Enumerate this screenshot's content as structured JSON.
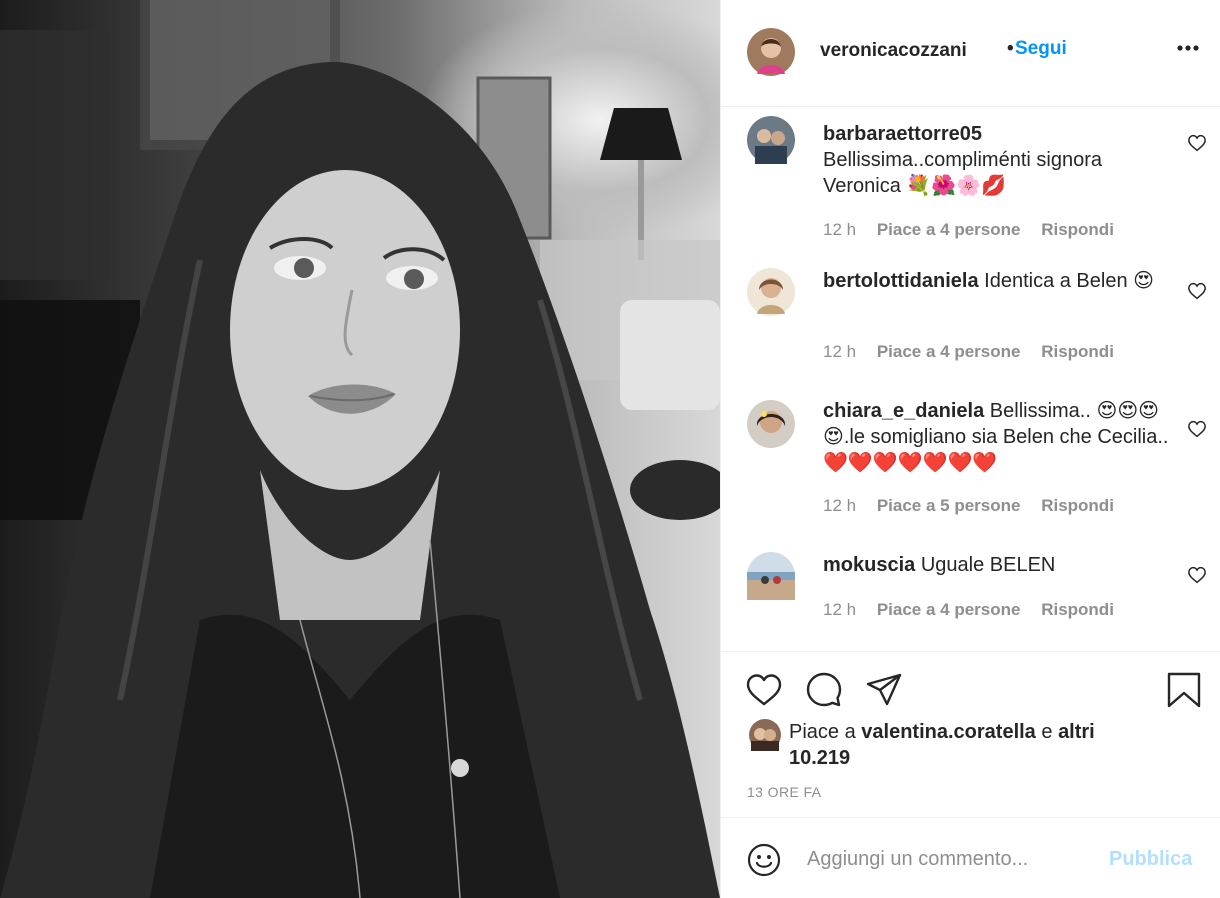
{
  "post": {
    "photo_alt": "photo"
  },
  "header": {
    "username": "veronicacozzani",
    "separator": "•",
    "follow_label": "Segui",
    "more_icon": "more-horizontal-icon"
  },
  "comments": [
    {
      "user": "barbaraettorre05",
      "text": "Bellissima..compliménti signora Veronica 💐🌺🌸💋",
      "age": "12 h",
      "likes": "Piace a 4 persone",
      "reply": "Rispondi"
    },
    {
      "user": "bertolottidaniela",
      "text": "Identica a Belen 😍",
      "age": "12 h",
      "likes": "Piace a 4 persone",
      "reply": "Rispondi"
    },
    {
      "user": "chiara_e_daniela",
      "text": "Bellissima.. 😍😍😍😍.le somigliano sia Belen che Cecilia..❤️❤️❤️❤️❤️❤️❤️",
      "age": "12 h",
      "likes": "Piace a 5 persone",
      "reply": "Rispondi"
    },
    {
      "user": "mokuscia",
      "text": "Uguale BELEN",
      "age": "12 h",
      "likes": "Piace a 4 persone",
      "reply": "Rispondi"
    }
  ],
  "actions": {
    "like_icon": "heart-icon",
    "comment_icon": "comment-bubble-icon",
    "share_icon": "paper-plane-icon",
    "save_icon": "bookmark-icon"
  },
  "likes": {
    "prefix": "Piace a",
    "user": "valentina.coratella",
    "conj": "e",
    "others": "altri 10.219"
  },
  "timestamp": "13 ORE FA",
  "add_comment": {
    "placeholder": "Aggiungi un commento...",
    "post_label": "Pubblica",
    "emoji_icon": "smiley-icon"
  },
  "colors": {
    "accent": "#0095f6",
    "post_disabled": "#b2dffc",
    "muted": "#8e8e8e",
    "text": "#262626",
    "border": "#efefef"
  }
}
